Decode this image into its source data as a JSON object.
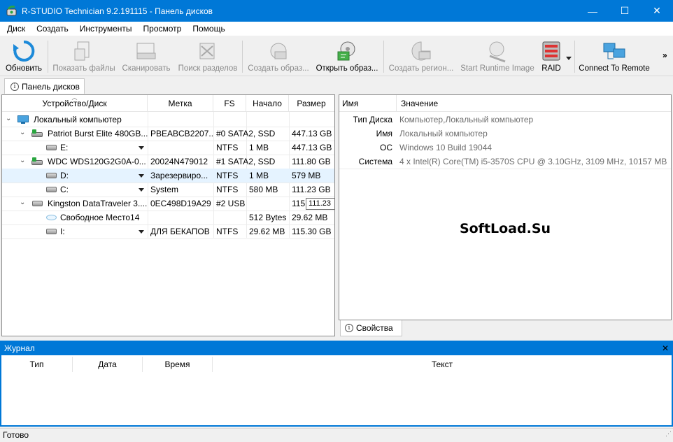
{
  "window": {
    "title": "R-STUDIO Technician 9.2.191115 - Панель дисков",
    "minimize": "—",
    "maximize": "☐",
    "close": "✕"
  },
  "menu": [
    "Диск",
    "Создать",
    "Инструменты",
    "Просмотр",
    "Помощь"
  ],
  "toolbar": {
    "buttons": [
      {
        "label": "Обновить",
        "icon": "refresh-icon",
        "enabled": true
      },
      {
        "label": "Показать файлы",
        "icon": "show-files-icon",
        "enabled": false
      },
      {
        "label": "Сканировать",
        "icon": "scan-icon",
        "enabled": false
      },
      {
        "label": "Поиск разделов",
        "icon": "find-partitions-icon",
        "enabled": false
      },
      {
        "label": "Создать образ...",
        "icon": "create-image-icon",
        "enabled": false
      },
      {
        "label": "Открыть образ...",
        "icon": "open-image-icon",
        "enabled": true
      },
      {
        "label": "Создать регион...",
        "icon": "create-region-icon",
        "enabled": false
      },
      {
        "label": "Start Runtime Image",
        "icon": "runtime-image-icon",
        "enabled": false
      },
      {
        "label": "RAID",
        "icon": "raid-icon",
        "enabled": true
      },
      {
        "label": "Connect To Remote",
        "icon": "remote-icon",
        "enabled": true
      }
    ],
    "overflow": "»"
  },
  "tabs": {
    "drives_panel": "Панель дисков",
    "properties": "Свойства"
  },
  "drives": {
    "columns": [
      "Устройство/Диск",
      "Метка",
      "FS",
      "Начало",
      "Размер"
    ],
    "rows": [
      {
        "name": "Локальный компьютер",
        "label": "",
        "fs": "",
        "start": "",
        "size": "",
        "type": "computer"
      },
      {
        "name": "Patriot Burst Elite 480GB...",
        "label": "PBEABCB2207...",
        "fs": "#0 SATA2, SSD",
        "start": "",
        "size": "447.13 GB",
        "type": "disk"
      },
      {
        "name": "E:",
        "label": "",
        "fs": "NTFS",
        "start": "1 MB",
        "size": "447.13 GB",
        "type": "partition"
      },
      {
        "name": "WDC WDS120G2G0A-0...",
        "label": "20024N479012",
        "fs": "#1 SATA2, SSD",
        "start": "",
        "size": "111.80 GB",
        "type": "disk"
      },
      {
        "name": "D:",
        "label": "Зарезервиро...",
        "fs": "NTFS",
        "start": "1 MB",
        "size": "579 MB",
        "type": "partition"
      },
      {
        "name": "C:",
        "label": "System",
        "fs": "NTFS",
        "start": "580 MB",
        "size": "111.23 GB",
        "type": "partition"
      },
      {
        "name": "Kingston DataTraveler 3....",
        "label": "0EC498D19A29",
        "fs": "#2 USB",
        "start": "",
        "size": "115.",
        "type": "usb"
      },
      {
        "name": "Свободное Место14",
        "label": "",
        "fs": "",
        "start": "512 Bytes",
        "size": "29.62 MB",
        "type": "free"
      },
      {
        "name": "I:",
        "label": "ДЛЯ БЕКАПОВ",
        "fs": "NTFS",
        "start": "29.62 MB",
        "size": "115.30 GB",
        "type": "partition"
      }
    ],
    "tooltip": "111.23"
  },
  "properties": {
    "columns": [
      "Имя",
      "Значение"
    ],
    "rows": [
      {
        "key": "Тип Диска",
        "value": "Компьютер,Локальный компьютер"
      },
      {
        "key": "Имя",
        "value": "Локальный компьютер"
      },
      {
        "key": "ОС",
        "value": "Windows 10 Build 19044"
      },
      {
        "key": "Система",
        "value": "4 x Intel(R) Core(TM) i5-3570S CPU @ 3.10GHz, 3109 MHz, 10157 MB ..."
      }
    ],
    "watermark": "SoftLoad.Su"
  },
  "journal": {
    "title": "Журнал",
    "close": "✕",
    "columns": [
      "Тип",
      "Дата",
      "Время",
      "Текст"
    ]
  },
  "status": {
    "text": "Готово"
  }
}
